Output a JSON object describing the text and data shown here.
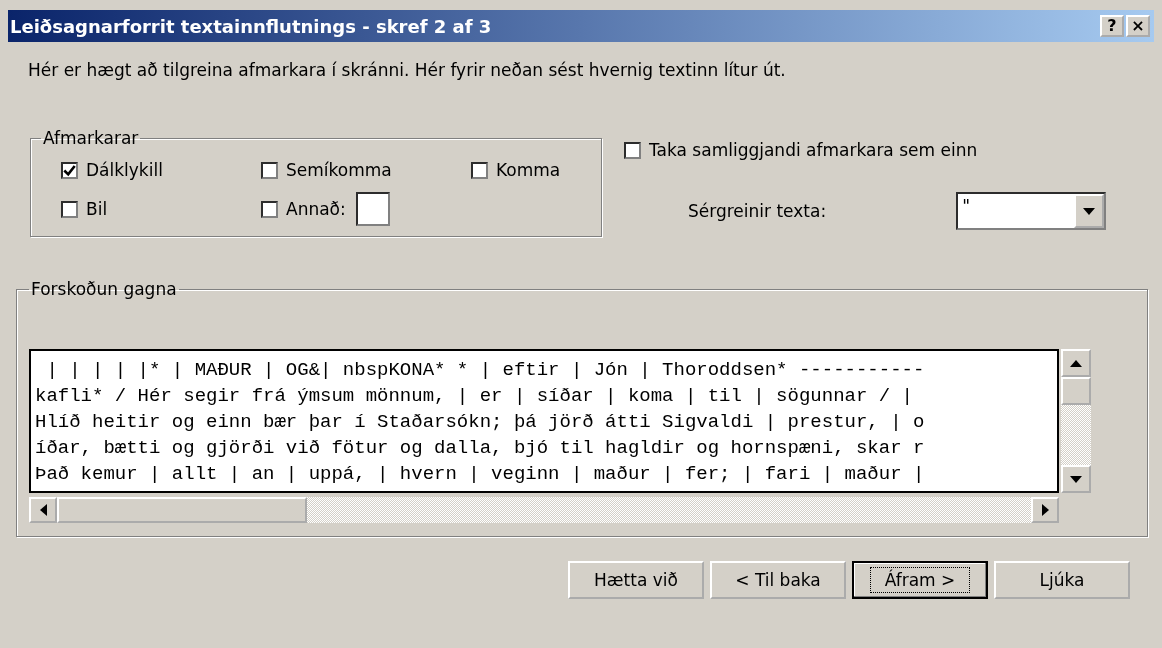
{
  "window": {
    "title": "Leiðsagnarforrit textainnflutnings - skref 2 af 3",
    "title_buttons": [
      "?",
      "×"
    ]
  },
  "intro": "Hér er hægt að tilgreina afmarkara í skránni.  Hér fyrir neðan sést hvernig textinn lítur út.",
  "delimiters": {
    "title": "Afmarkarar",
    "items": [
      {
        "label": "Dálklykill",
        "checked": true
      },
      {
        "label": "Semíkomma",
        "checked": false
      },
      {
        "label": "Komma",
        "checked": false
      },
      {
        "label": "Bil",
        "checked": false
      },
      {
        "label": "Annað:",
        "checked": false,
        "kind": "other"
      }
    ]
  },
  "consecutive": {
    "label": "Taka samliggjandi afmarkara sem einn",
    "checked": false
  },
  "text_qualifier": {
    "label": "Sérgreinir texta:",
    "value": "\""
  },
  "preview": {
    "title": "Forskoðun gagna",
    "lines": [
      " | | | | |* | MAÐUR | OG&| nbspKONA* * | eftir | Jón | Thoroddsen* -----------",
      "kafli* / Hér segir frá ýmsum mönnum, | er | síðar | koma | til | sögunnar / |",
      "Hlíð heitir og einn bær þar í Staðarsókn; þá jörð átti Sigvaldi | prestur, | o",
      "íðar, bætti og gjörði við fötur og dalla, bjó til hagldir og hornspæni, skar r",
      "Það kemur | allt | an | uppá, | hvern | veginn | maður | fer; | fari | maður |"
    ]
  },
  "buttons": [
    {
      "label": "Hætta við",
      "default": false
    },
    {
      "label": "< Til baka",
      "default": false
    },
    {
      "label": "Áfram >",
      "default": true
    },
    {
      "label": "Ljúka",
      "default": false
    }
  ]
}
